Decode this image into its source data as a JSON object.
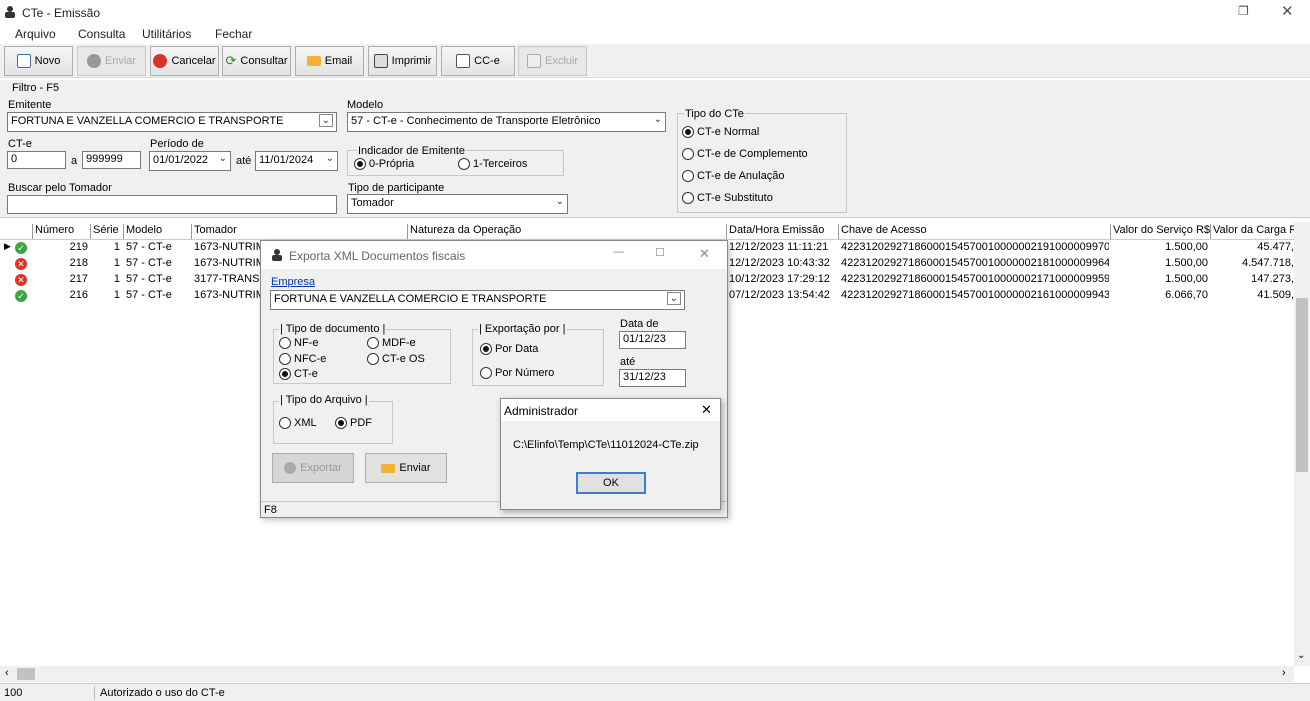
{
  "window": {
    "title": "CTe - Emissão"
  },
  "menu": [
    "Arquivo",
    "Consulta",
    "Utilitários",
    "Fechar"
  ],
  "toolbar": {
    "novo": "Novo",
    "enviar": "Enviar",
    "cancelar": "Cancelar",
    "consultar": "Consultar",
    "email": "Email",
    "imprimir": "Imprimir",
    "cce": "CC-e",
    "excluir": "Excluir"
  },
  "filter": {
    "title": "Filtro - F5",
    "emitente_label": "Emitente",
    "emitente_value": "FORTUNA E VANZELLA COMERCIO E TRANSPORTE",
    "modelo_label": "Modelo",
    "modelo_value": "57 - CT-e - Conhecimento de Transporte Eletrônico",
    "cte_label": "CT-e",
    "cte_from": "0",
    "a_label": "a",
    "cte_to": "999999",
    "periodo_label": "Período de",
    "periodo_from": "01/01/2022",
    "ate_label": "até",
    "periodo_to": "11/01/2024",
    "indicador_label": "Indicador de Emitente",
    "indicador_opt1": "0-Própria",
    "indicador_opt2": "1-Terceiros",
    "buscar_label": "Buscar pelo Tomador",
    "buscar_value": "",
    "participante_label": "Tipo de participante",
    "participante_value": "Tomador",
    "tipo_label": "Tipo do CTe",
    "tipo_opts": [
      "CT-e Normal",
      "CT-e de Complemento",
      "CT-e de Anulação",
      "CT-e Substituto"
    ]
  },
  "grid": {
    "headers": [
      "Número",
      "Série",
      "Modelo",
      "Tomador",
      "Natureza da Operação",
      "Data/Hora Emissão",
      "Chave de Acesso",
      "Valor do Serviço R$",
      "Valor da Carga R$"
    ],
    "rows": [
      {
        "status": "ok",
        "numero": "219",
        "serie": "1",
        "modelo": "57 - CT-e",
        "tomador": "1673-NUTRIM",
        "data": "12/12/2023 11:11:21",
        "chave": "42231202927186000154570010000002191000009970",
        "valor": "1.500,00",
        "carga": "45.477,"
      },
      {
        "status": "err",
        "numero": "218",
        "serie": "1",
        "modelo": "57 - CT-e",
        "tomador": "1673-NUTRIM",
        "data": "12/12/2023 10:43:32",
        "chave": "42231202927186000154570010000002181000009964",
        "valor": "1.500,00",
        "carga": "4.547.718,"
      },
      {
        "status": "err",
        "numero": "217",
        "serie": "1",
        "modelo": "57 - CT-e",
        "tomador": "3177-TRANSF",
        "data": "10/12/2023 17:29:12",
        "chave": "42231202927186000154570010000002171000009959",
        "valor": "1.500,00",
        "carga": "147.273,"
      },
      {
        "status": "ok",
        "numero": "216",
        "serie": "1",
        "modelo": "57 - CT-e",
        "tomador": "1673-NUTRIM",
        "data": "07/12/2023 13:54:42",
        "chave": "42231202927186000154570010000002161000009943",
        "valor": "6.066,70",
        "carga": "41.509,"
      }
    ]
  },
  "status": {
    "count": "100",
    "message": "Autorizado o uso do CT-e"
  },
  "export_dialog": {
    "title": "Exporta XML Documentos fiscais",
    "empresa_label": "Empresa",
    "empresa_value": "FORTUNA E VANZELLA COMERCIO E TRANSPORTE",
    "tipo_doc_label": "| Tipo de documento |",
    "doc_opts": [
      "NF-e",
      "MDF-e",
      "NFC-e",
      "CT-e OS",
      "CT-e"
    ],
    "exportacao_label": "| Exportação por |",
    "por_data": "Por Data",
    "por_numero": "Por Número",
    "data_de_label": "Data de",
    "data_de": "01/12/23",
    "ate_label": "até",
    "data_ate": "31/12/23",
    "tipo_arquivo_label": "| Tipo do Arquivo |",
    "xml": "XML",
    "pdf": "PDF",
    "exportar": "Exportar",
    "enviar": "Enviar",
    "footer": "F8"
  },
  "msg_dialog": {
    "title": "Administrador",
    "message": "C:\\Elinfo\\Temp\\CTe\\11012024-CTe.zip",
    "ok": "OK"
  }
}
